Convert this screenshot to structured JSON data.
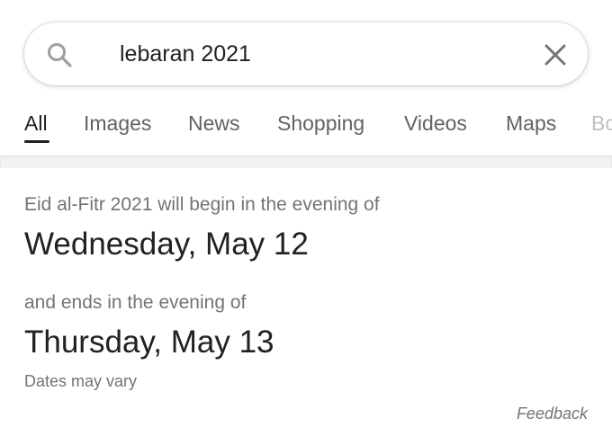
{
  "search": {
    "query": "lebaran 2021",
    "search_icon": "search-icon",
    "clear_icon": "close-icon"
  },
  "tabs": [
    {
      "label": "All",
      "active": true
    },
    {
      "label": "Images",
      "active": false
    },
    {
      "label": "News",
      "active": false
    },
    {
      "label": "Shopping",
      "active": false
    },
    {
      "label": "Videos",
      "active": false
    },
    {
      "label": "Maps",
      "active": false
    },
    {
      "label": "Books",
      "active": false
    }
  ],
  "result": {
    "intro": "Eid al-Fitr 2021 will begin in the evening of",
    "start_date": "Wednesday, May 12",
    "end_intro": "and ends in the evening of",
    "end_date": "Thursday, May 13",
    "note": "Dates may vary",
    "feedback": "Feedback"
  },
  "colors": {
    "text_primary": "#202124",
    "text_secondary": "#70757a",
    "tab_inactive": "#5f6368",
    "divider": "#f1f3f4"
  }
}
